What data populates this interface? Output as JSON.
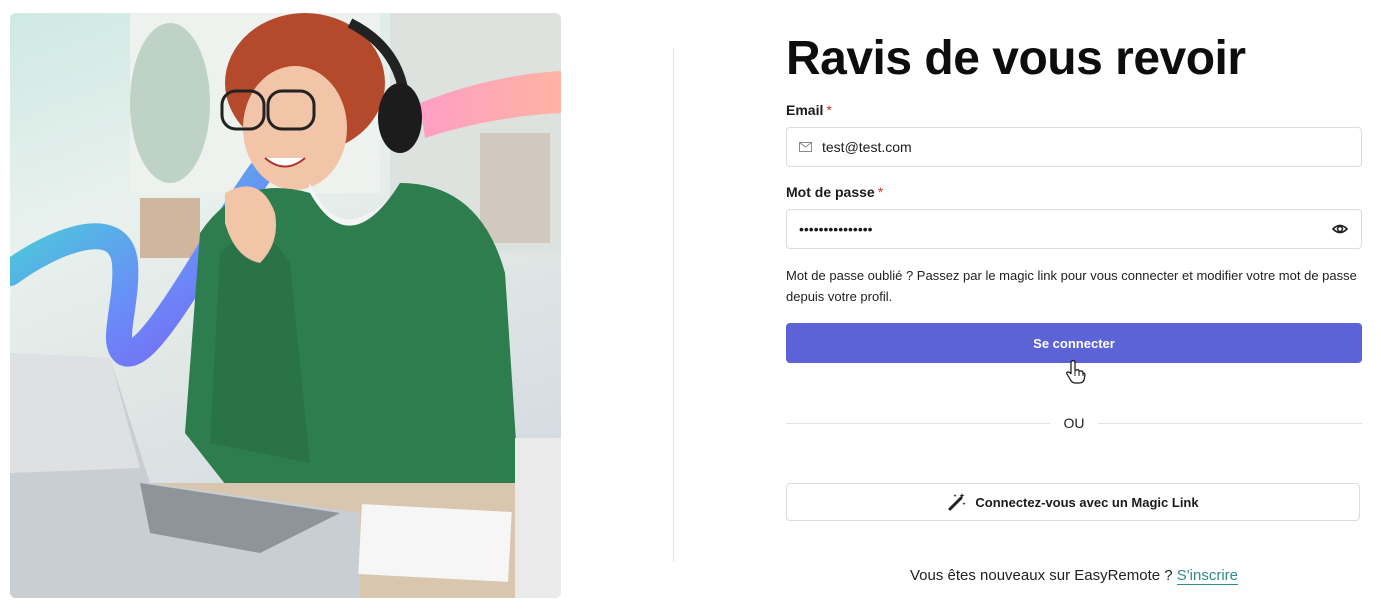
{
  "page": {
    "title": "Ravis de vous revoir"
  },
  "form": {
    "email_label": "Email",
    "email_required_mark": "*",
    "email_value": "test@test.com",
    "password_label": "Mot de passe",
    "password_required_mark": "*",
    "password_value_masked": "•••••••••••••••",
    "hint_text": "Mot de passe oublié ? Passez par le magic link pour vous connecter et modifier votre mot de passe depuis votre profil.",
    "submit_label": "Se connecter",
    "separator_text": "OU",
    "magic_link_label": "Connectez-vous avec un Magic Link"
  },
  "signup": {
    "prompt": "Vous êtes nouveaux sur EasyRemote ?",
    "link_label": "S'inscrire"
  },
  "icons": {
    "email": "mail-icon",
    "password_toggle": "eye-icon",
    "magic_link": "magic-wand-icon",
    "cursor": "hand-pointer-icon"
  },
  "colors": {
    "primary": "#5b63d6",
    "link": "#2f8a8a",
    "required": "#d9312b"
  }
}
